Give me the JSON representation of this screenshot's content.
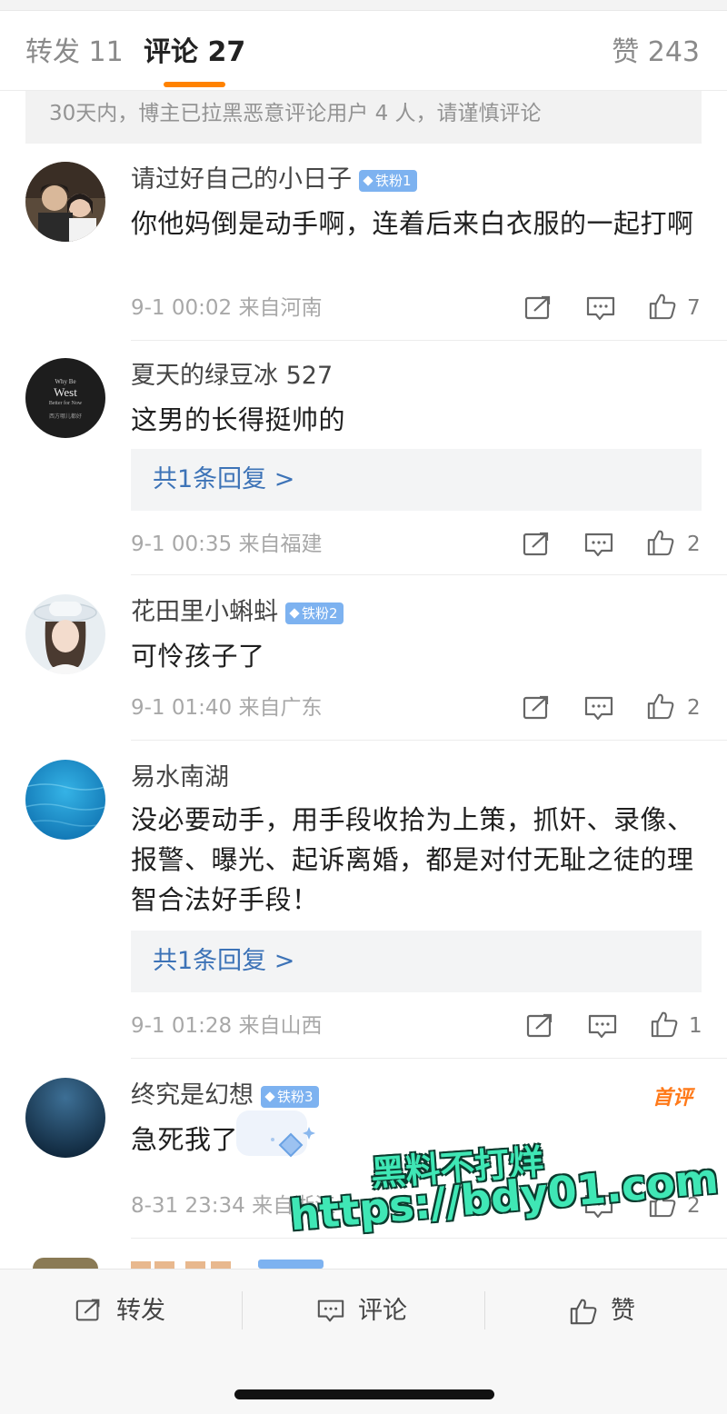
{
  "tabs": {
    "repost": "转发 11",
    "comments": "评论 27",
    "likes": "赞 243"
  },
  "notice": "30天内，博主已拉黑恶意评论用户 4 人，请谨慎评论",
  "comments": [
    {
      "username": "请过好自己的小日子",
      "badge": "铁粉1",
      "text": "你他妈倒是动手啊，连着后来白衣服的一起打啊",
      "meta": "9-1 00:02 来自河南",
      "likes": "7"
    },
    {
      "username": "夏天的绿豆冰 527",
      "avatar_text": [
        "Why Be",
        "West",
        "Better for Now",
        "西方哪儿都好"
      ],
      "text": "这男的长得挺帅的",
      "reply": "共1条回复 >",
      "meta": "9-1 00:35 来自福建",
      "likes": "2"
    },
    {
      "username": "花田里小蝌蚪",
      "badge": "铁粉2",
      "text": "可怜孩子了",
      "meta": "9-1 01:40 来自广东",
      "likes": "2"
    },
    {
      "username": "易水南湖",
      "text": "没必要动手，用手段收拾为上策，抓奸、录像、报警、曝光、起诉离婚，都是对付无耻之徒的理智合法好手段！",
      "reply": "共1条回复 >",
      "meta": "9-1 01:28 来自山西",
      "likes": "1"
    },
    {
      "username": "终究是幻想",
      "badge": "铁粉3",
      "tag": "首评",
      "text": "急死我了",
      "meta": "8-31 23:34 来自浙江",
      "likes": "2"
    }
  ],
  "watermark": {
    "line1": "黑料不打烊",
    "line2": "https://bdy01.com"
  },
  "bottom_bar": {
    "repost": "转发",
    "comment": "评论",
    "like": "赞"
  },
  "colors": {
    "accent": "#ff8200",
    "link": "#3d73b7",
    "badge": "#7db2f0",
    "watermark": "#3fe7b5"
  }
}
